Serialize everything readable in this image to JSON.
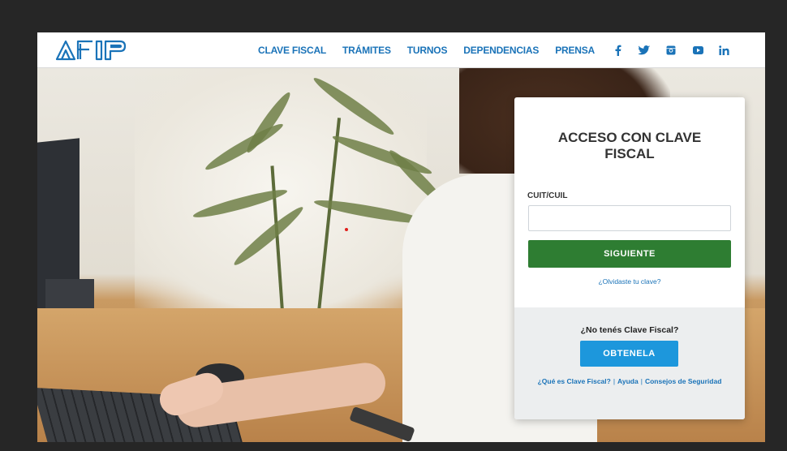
{
  "brand": {
    "logo_text": "AFIP",
    "logo_color": "#1a73b8"
  },
  "nav": {
    "items": [
      {
        "label": "CLAVE FISCAL"
      },
      {
        "label": "TRÁMITES"
      },
      {
        "label": "TURNOS"
      },
      {
        "label": "DEPENDENCIAS"
      },
      {
        "label": "PRENSA"
      }
    ],
    "social": [
      {
        "icon": "facebook-icon",
        "glyph": "f"
      },
      {
        "icon": "twitter-icon",
        "glyph": "🐦"
      },
      {
        "icon": "instagram-icon",
        "glyph": "◙"
      },
      {
        "icon": "youtube-icon",
        "glyph": "▶"
      },
      {
        "icon": "linkedin-icon",
        "glyph": "in"
      }
    ]
  },
  "login": {
    "title": "ACCESO CON CLAVE FISCAL",
    "field_label": "CUIT/CUIL",
    "field_value": "",
    "next_button": "SIGUIENTE",
    "forgot_link": "¿Olvidaste tu clave?",
    "no_clave_text": "¿No tenés Clave Fiscal?",
    "obtain_button": "OBTENELA",
    "help_links": {
      "what_is": "¿Qué es Clave Fiscal?",
      "separator": "|",
      "help": "Ayuda",
      "security": "Consejos de Seguridad"
    }
  },
  "colors": {
    "primary_blue": "#1a73b8",
    "next_green": "#2e7d32",
    "obtain_blue": "#1d97dc"
  }
}
